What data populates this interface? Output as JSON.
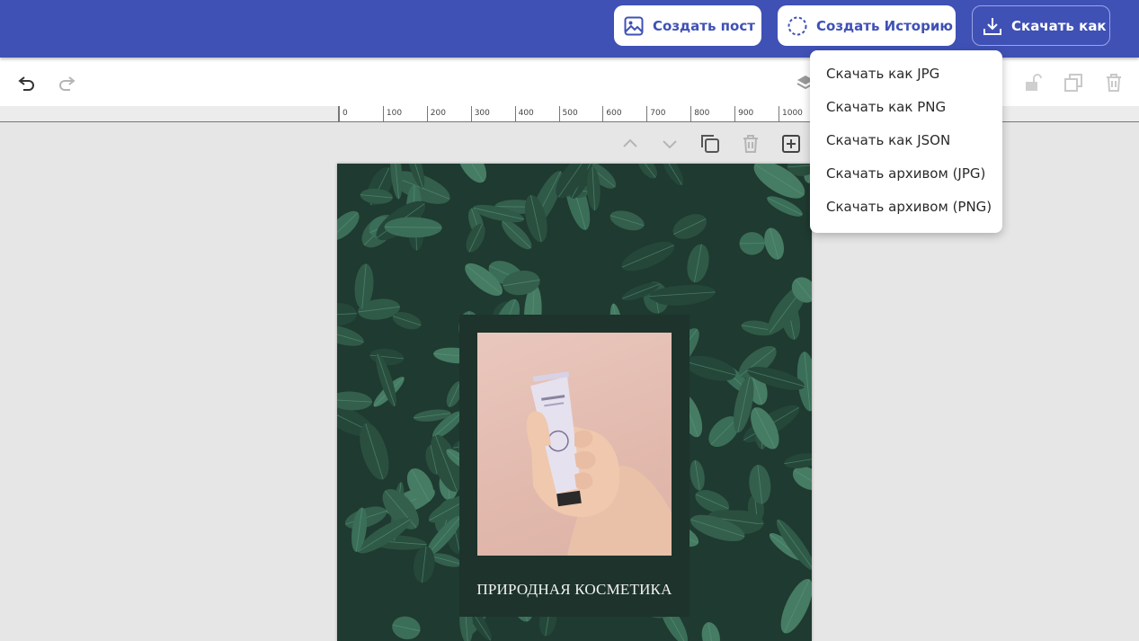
{
  "header": {
    "create_post_label": "Создать пост",
    "create_story_label": "Создать Историю",
    "download_label": "Скачать как",
    "bar_color": "#3f51b5"
  },
  "download_menu": {
    "items": [
      {
        "label": "Скачать как JPG"
      },
      {
        "label": "Скачать как PNG"
      },
      {
        "label": "Скачать как JSON"
      },
      {
        "label": "Скачать архивом (JPG)"
      },
      {
        "label": "Скачать архивом (PNG)"
      }
    ]
  },
  "toolbar": {
    "icons": [
      "undo-icon",
      "redo-icon",
      "layers-icon",
      "unlock-icon",
      "duplicate-icon",
      "delete-icon"
    ]
  },
  "ruler": {
    "labels": [
      "0",
      "100",
      "200",
      "300",
      "400",
      "500",
      "600",
      "700",
      "800",
      "900",
      "1000"
    ]
  },
  "page_actions": {
    "icons": [
      "move-up-icon",
      "move-down-icon",
      "copy-page-icon",
      "delete-page-icon",
      "add-page-icon"
    ]
  },
  "canvas": {
    "caption": "ПРИРОДНАЯ КОСМЕТИКА"
  }
}
